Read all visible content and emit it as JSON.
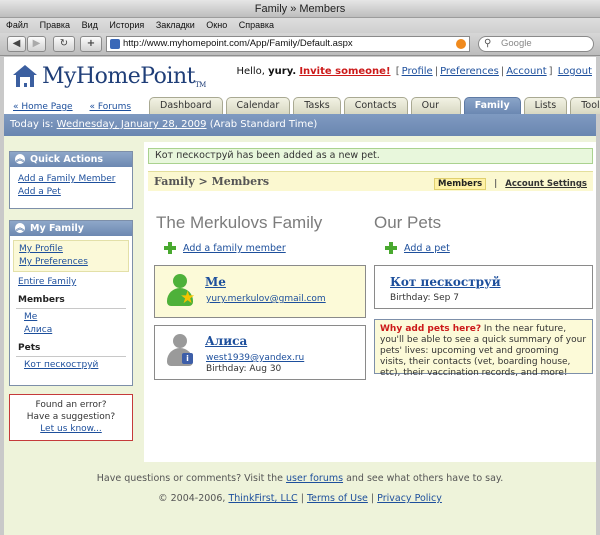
{
  "window": {
    "title": "Family » Members"
  },
  "menu": [
    "Файл",
    "Правка",
    "Вид",
    "История",
    "Закладки",
    "Окно",
    "Справка"
  ],
  "browser": {
    "url": "http://www.myhomepoint.com/App/Family/Default.aspx",
    "search_placeholder": "Google"
  },
  "header": {
    "logo_text": "MyHomePoint",
    "logo_tm": "TM",
    "greeting": "Hello,",
    "username": "yury.",
    "invite": "Invite someone!",
    "links": [
      "Profile",
      "Preferences",
      "Account",
      "Logout"
    ]
  },
  "toplinks": [
    "« Home Page",
    "« Forums"
  ],
  "tabs": [
    "Dashboard",
    "Calendar",
    "Tasks",
    "Contacts",
    "Our Home",
    "Family",
    "Lists",
    "Tools"
  ],
  "active_tab": "Family",
  "datebar": {
    "prefix": "Today is:",
    "date": "Wednesday, January 28, 2009",
    "tz": "(Arab Standard Time)"
  },
  "quick_actions": {
    "title": "Quick Actions",
    "items": [
      "Add a Family Member",
      "Add a Pet"
    ]
  },
  "my_family": {
    "title": "My Family",
    "sub_items": [
      "My Profile",
      "My Preferences"
    ],
    "entire": "Entire Family",
    "members_label": "Members",
    "members": [
      "Me",
      "Алиса"
    ],
    "pets_label": "Pets",
    "pets": [
      "Кот пескоструй"
    ]
  },
  "error_box": {
    "line1": "Found an error?",
    "line2": "Have a suggestion?",
    "link": "Let us know..."
  },
  "notice": "Кот пескоструй has been added as a new pet.",
  "breadcrumb": "Family > Members",
  "view_links": {
    "current": "Members",
    "other": "Account Settings"
  },
  "family": {
    "title": "The Merkulovs Family",
    "add_label": "Add a family member",
    "members": [
      {
        "name": "Me",
        "email": "yury.merkulov@gmail.com",
        "birthday": ""
      },
      {
        "name": "Алиса",
        "email": "west1939@yandex.ru",
        "birthday": "Birthday: Aug 30"
      }
    ]
  },
  "pets": {
    "title": "Our Pets",
    "add_label": "Add a pet",
    "items": [
      {
        "name": "Кот пескоструй",
        "birthday": "Birthday: Sep 7"
      }
    ],
    "info_title": "Why add pets here?",
    "info_text": " In the near future, you'll be able to see a quick summary of your pets' lives: upcoming vet and grooming visits, their contacts (vet, boarding house, etc), their vaccination records, and more!"
  },
  "footer": {
    "l1_a": "Have questions or comments? Visit the",
    "l1_link": "user forums",
    "l1_b": "and see what others have to say.",
    "copyright": "© 2004-2006,",
    "company": "ThinkFirst, LLC",
    "terms": "Terms of Use",
    "privacy": "Privacy Policy"
  },
  "colors": {
    "accent_blue": "#6c88b1",
    "invite_red": "#cc1a1a",
    "link_blue": "#1d4f9c",
    "content_bg": "#eef3da"
  }
}
